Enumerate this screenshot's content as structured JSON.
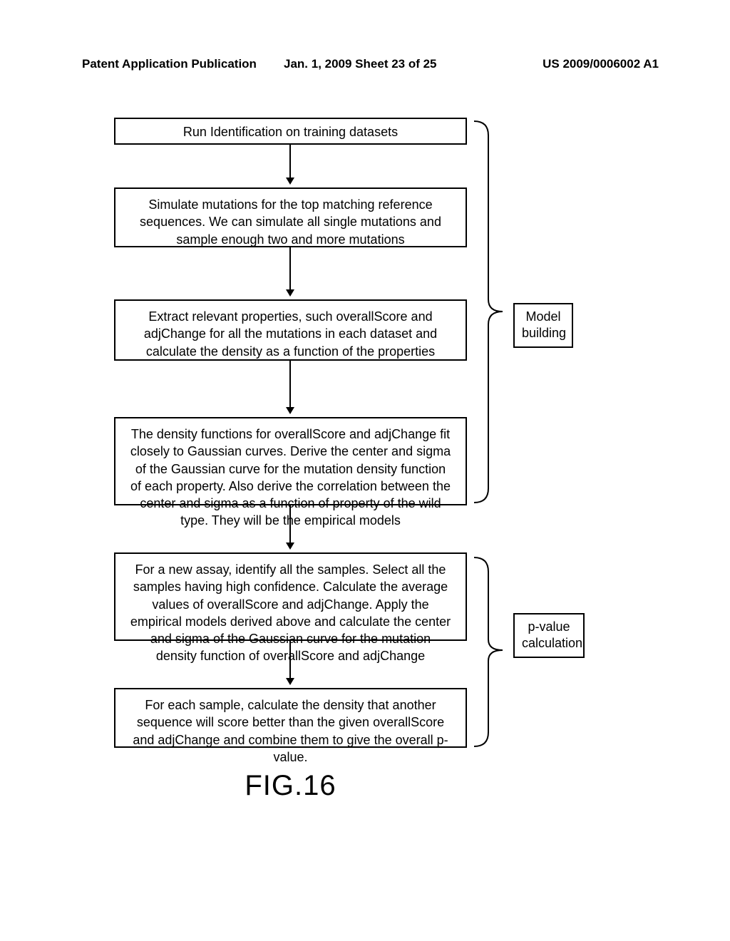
{
  "header": {
    "left": "Patent Application Publication",
    "center": "Jan. 1, 2009   Sheet 23 of 25",
    "right": "US 2009/0006002 A1"
  },
  "boxes": {
    "box1": "Run Identification on training datasets",
    "box2": "Simulate mutations for the top matching reference sequences. We can simulate all single mutations and sample enough two and more mutations",
    "box3": "Extract relevant properties, such overallScore and adjChange for all the mutations in each dataset and calculate the density as a function of the properties",
    "box4": "The density functions for overallScore and adjChange fit closely to Gaussian curves. Derive the center and sigma of the Gaussian curve for the mutation density function of each property. Also derive the correlation between the center and sigma as a function of property of the wild type. They will be the empirical models",
    "box5": "For a new assay, identify all the samples. Select all the samples having high confidence. Calculate the average values of overallScore and adjChange. Apply the empirical models derived above and calculate the center and sigma of the Gaussian curve for the mutation density function of overallScore and adjChange",
    "box6": "For each sample, calculate the density that another sequence will score better than the given overallScore and adjChange and combine them to give the overall p-value."
  },
  "labels": {
    "label1_line1": "Model",
    "label1_line2": "building",
    "label2_line1": "p-value",
    "label2_line2": "calculation"
  },
  "figure": "FIG.16"
}
